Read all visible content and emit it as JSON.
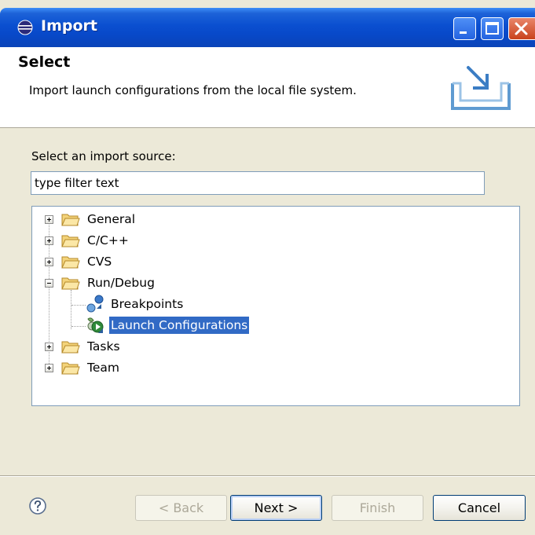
{
  "window": {
    "title": "Import"
  },
  "banner": {
    "title": "Select",
    "description": "Import launch configurations from the local file system."
  },
  "source": {
    "label": "Select an import source:",
    "filter_value": "type filter text"
  },
  "tree": {
    "items": [
      {
        "label": "General",
        "expanded": false
      },
      {
        "label": "C/C++",
        "expanded": false
      },
      {
        "label": "CVS",
        "expanded": false
      },
      {
        "label": "Run/Debug",
        "expanded": true,
        "children": [
          {
            "label": "Breakpoints",
            "icon": "breakpoints-icon"
          },
          {
            "label": "Launch Configurations",
            "icon": "launch-configurations-icon",
            "selected": true
          }
        ]
      },
      {
        "label": "Tasks",
        "expanded": false
      },
      {
        "label": "Team",
        "expanded": false
      }
    ]
  },
  "buttons": {
    "back": "< Back",
    "next": "Next >",
    "finish": "Finish",
    "cancel": "Cancel"
  },
  "colors": {
    "selection": "#316ac5",
    "titlebar": "#0a4fd0",
    "dialog_bg": "#ece9d8"
  }
}
